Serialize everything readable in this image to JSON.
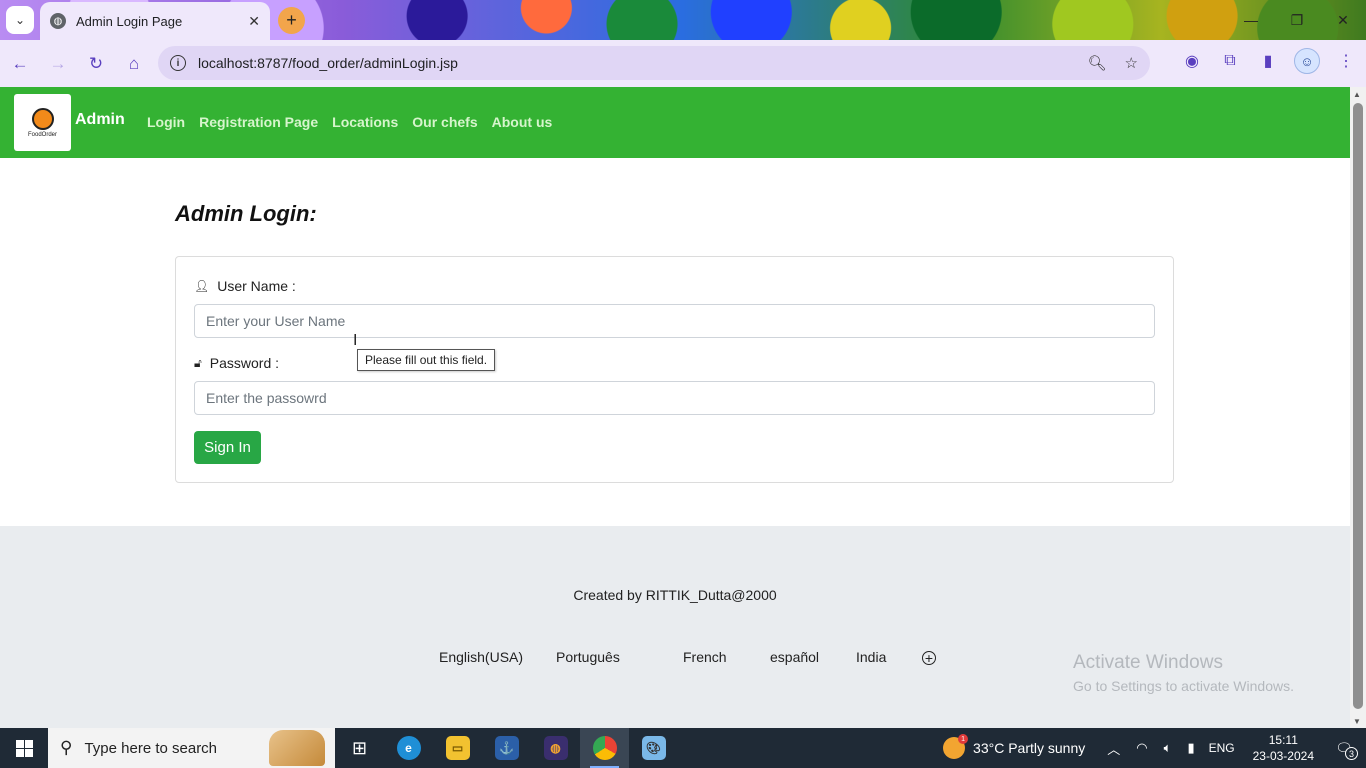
{
  "browser": {
    "tab_title": "Admin Login Page",
    "url": "localhost:8787/food_order/adminLogin.jsp"
  },
  "navbar": {
    "brand": "Admin",
    "logo_text": "FoodOrder",
    "links": [
      "Login",
      "Registration Page",
      "Locations",
      "Our chefs",
      "About us"
    ],
    "color": "#34b233"
  },
  "form": {
    "heading": "Admin Login:",
    "username_label": "User Name :",
    "username_placeholder": "Enter your User Name",
    "password_label": "Password :",
    "password_placeholder": "Enter the passowrd",
    "validation_tooltip": "Please fill out this field.",
    "submit_label": "Sign In",
    "submit_color": "#28a745"
  },
  "footer": {
    "credit": "Created by RITTIK_Dutta@2000",
    "languages": [
      "English(USA)",
      "Português",
      "French",
      "español",
      "India"
    ]
  },
  "watermark": {
    "title": "Activate Windows",
    "subtitle": "Go to Settings to activate Windows."
  },
  "taskbar": {
    "search_placeholder": "Type here to search",
    "weather": "33°C  Partly sunny",
    "weather_badge": "1",
    "language": "ENG",
    "time": "15:11",
    "date": "23-03-2024",
    "notification_count": "3"
  }
}
